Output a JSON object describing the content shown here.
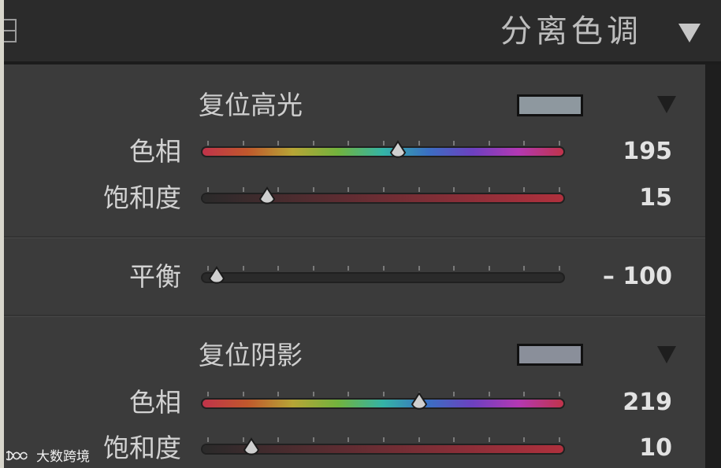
{
  "panel": {
    "title": "分离色调"
  },
  "highlights": {
    "title": "复位高光",
    "swatch_color": "#8e989f",
    "hue_label": "色相",
    "hue_value": "195",
    "hue_fraction": 0.542,
    "saturation_label": "饱和度",
    "saturation_value": "15",
    "saturation_fraction": 0.18
  },
  "balance": {
    "label": "平衡",
    "value": "– 100",
    "fraction": 0.04
  },
  "shadows": {
    "title": "复位阴影",
    "swatch_color": "#8a8f9a",
    "hue_label": "色相",
    "hue_value": "219",
    "hue_fraction": 0.6,
    "saturation_label": "饱和度",
    "saturation_value": "10",
    "saturation_fraction": 0.135
  },
  "colors": {
    "hue_gradient": [
      "#c0334a",
      "#c0582c",
      "#b7a536",
      "#72b33d",
      "#34b4a6",
      "#3a6fc2",
      "#6d40c0",
      "#b338b3",
      "#c0334a"
    ],
    "saturation_start": "#2a2a2a",
    "saturation_end": "#b0303d",
    "balance_track": "#2a2a2a"
  },
  "watermark": {
    "text": "大数跨境"
  }
}
